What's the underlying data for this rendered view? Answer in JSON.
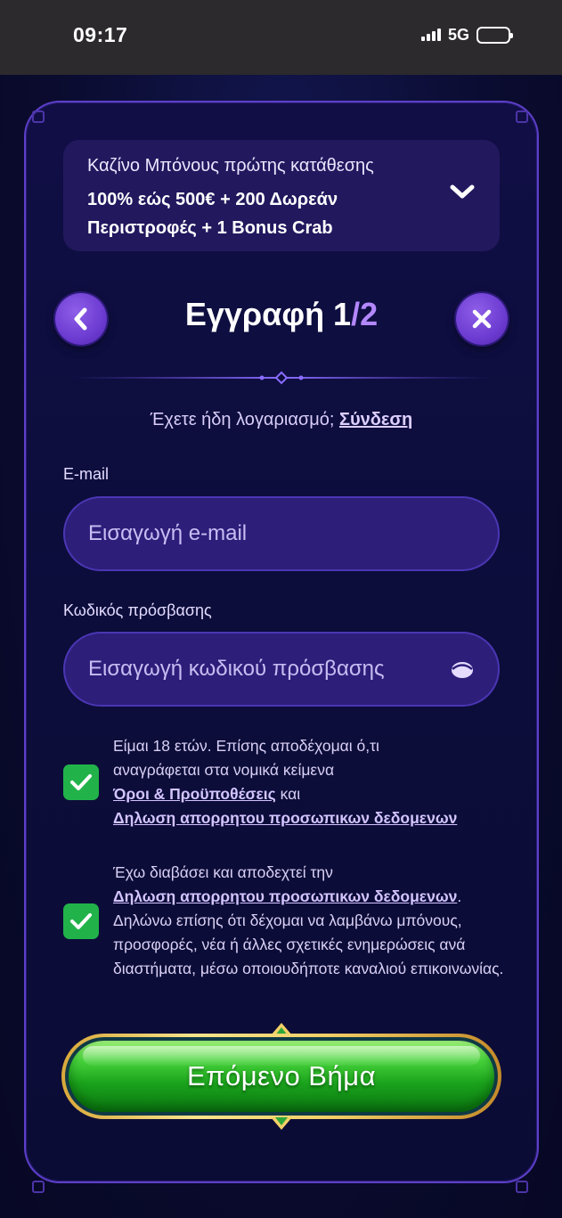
{
  "status_bar": {
    "time": "09:17",
    "network": "5G"
  },
  "bonus": {
    "title": "Καζίνο Μπόνους πρώτης κατάθεσης",
    "line1": "100% εώς 500€ + 200 Δωρεάν",
    "line2": "Περιστροφές + 1 Bonus Crab"
  },
  "header": {
    "title": "Εγγραφή 1",
    "step_total": "/2"
  },
  "login": {
    "prompt": "Έχετε ήδη λογαριασμό;",
    "link": "Σύνδεση"
  },
  "email": {
    "label": "E-mail",
    "placeholder": "Εισαγωγή e-mail"
  },
  "password": {
    "label": "Κωδικός πρόσβασης",
    "placeholder": "Εισαγωγή κωδικού πρόσβασης"
  },
  "consent1": {
    "checked": true,
    "line1": "Είμαι 18 ετών. Επίσης αποδέχομαι ό,τι",
    "line2": "αναγράφεται στα νομικά κείμενα",
    "terms_link": "Όροι & Προϋποθέσεις",
    "and": "και",
    "privacy_link": "Δηλωση απορρητου προσωπικων δεδομενων"
  },
  "consent2": {
    "checked": true,
    "line1": "Έχω διαβάσει και αποδεχτεί την",
    "privacy_link": "Δηλωση απορρητου προσωπικων δεδομενων",
    "after_link": ".",
    "rest": "Δηλώνω επίσης ότι δέχομαι να λαμβάνω μπόνους, προσφορές, νέα ή άλλες σχετικές ενημερώσεις ανά διαστήματα, μέσω οποιουδήποτε καναλιού επικοινωνίας."
  },
  "next_button": {
    "label": "Επόμενο Βήμα"
  },
  "colors": {
    "accent": "#6c3bd1",
    "checkbox": "#21b34a",
    "field_bg": "#2d1e7a",
    "button_green": "#1aa21c",
    "button_gold": "#f3d067"
  },
  "icons": {
    "back": "chevron-left-icon",
    "close": "close-icon",
    "expand": "chevron-down-icon",
    "eye": "eye-icon",
    "check": "check-icon"
  }
}
